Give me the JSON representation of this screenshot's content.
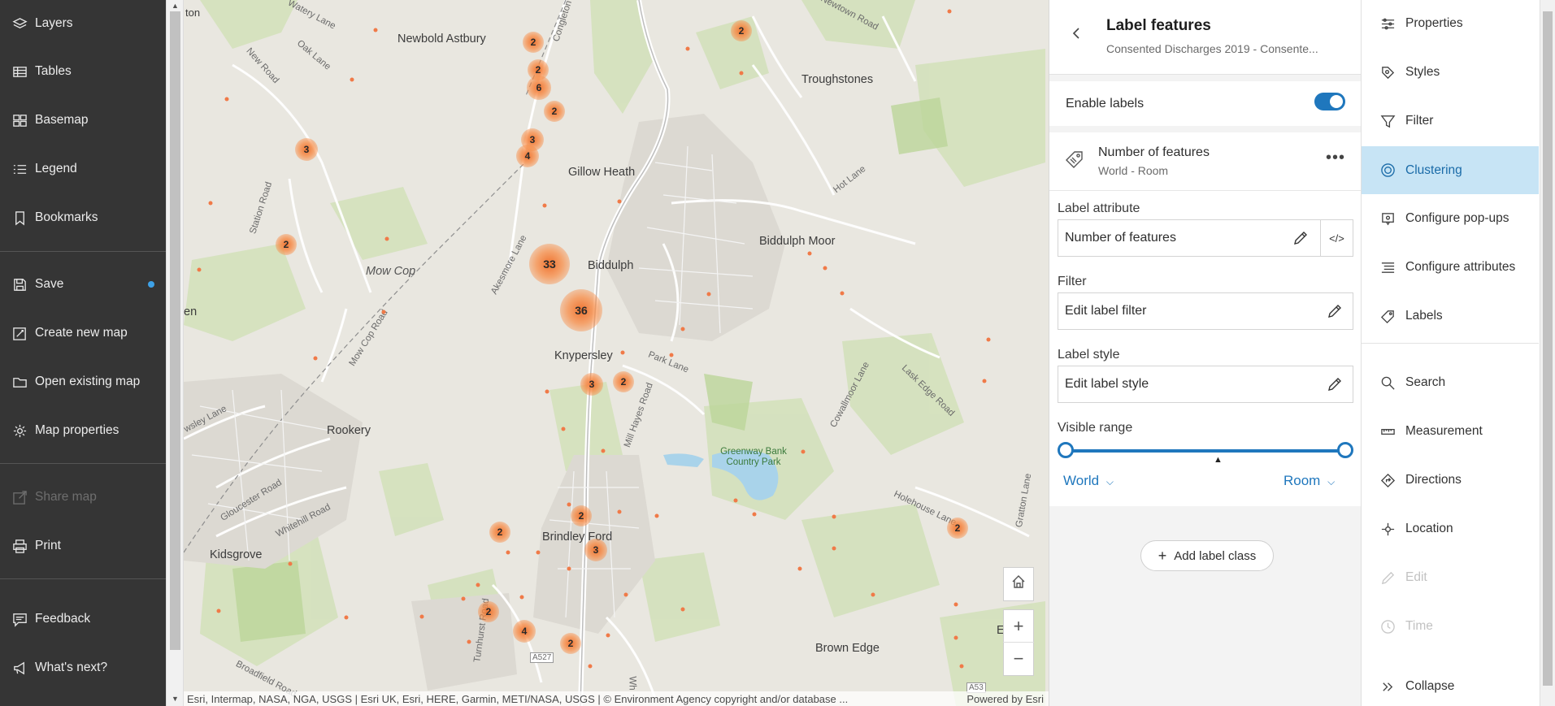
{
  "left_nav": {
    "items": [
      {
        "label": "Layers",
        "icon": "layers-icon"
      },
      {
        "label": "Tables",
        "icon": "table-icon"
      },
      {
        "label": "Basemap",
        "icon": "basemap-icon"
      },
      {
        "label": "Legend",
        "icon": "legend-icon"
      },
      {
        "label": "Bookmarks",
        "icon": "bookmark-icon"
      },
      {
        "label": "Save",
        "icon": "save-icon"
      },
      {
        "label": "Create new map",
        "icon": "create-map-icon"
      },
      {
        "label": "Open existing map",
        "icon": "folder-icon"
      },
      {
        "label": "Map properties",
        "icon": "gear-icon"
      },
      {
        "label": "Share map",
        "icon": "share-icon",
        "disabled": true
      },
      {
        "label": "Print",
        "icon": "print-icon"
      },
      {
        "label": "Feedback",
        "icon": "feedback-icon"
      },
      {
        "label": "What's next?",
        "icon": "megaphone-icon"
      }
    ],
    "unsaved_dot_color": "#3ea2e8"
  },
  "map": {
    "places": [
      "Newbold Astbury",
      "Troughstones",
      "Gillow Heath",
      "Biddulph Moor",
      "Biddulph",
      "Mow Cop",
      "Knypersley",
      "Rookery",
      "Kidsgrove",
      "Brindley Ford",
      "Brown Edge",
      "Greenway Bank Country Park"
    ],
    "streets": [
      "Watery Lane",
      "Congleton",
      "Newtown Road",
      "New Road",
      "Oak Lane",
      "Station Road",
      "Station Road",
      "Akesmore Lane",
      "Hot Lane",
      "Mow Cop Road",
      "Park Lane",
      "Mill Hayes Road",
      "Cowallmoor Lane",
      "Lask Edge Road",
      "Gloucester Road",
      "Whitehill Road",
      "Holehouse Lane",
      "Gratton Lane",
      "Turnhurst Road",
      "Broadfield Road",
      "A527",
      "A53"
    ],
    "edge_labels": [
      "ton",
      "en",
      "wsley Lane",
      "E",
      "Wh"
    ],
    "clusters": [
      "2",
      "2",
      "2",
      "6",
      "2",
      "3",
      "4",
      "3",
      "2",
      "33",
      "36",
      "3",
      "2",
      "2",
      "2",
      "3",
      "2",
      "4",
      "2",
      "2"
    ],
    "attribution": "Esri, Intermap, NASA, NGA, USGS | Esri UK, Esri, HERE, Garmin, METI/NASA, USGS | © Environment Agency copyright and/or database ...",
    "powered_by": "Powered by Esri",
    "controls": {
      "home": "home-icon",
      "zoom_in": "+",
      "zoom_out": "−"
    }
  },
  "panel": {
    "title": "Label features",
    "subtitle": "Consented Discharges 2019 - Consente...",
    "enable_labels": "Enable labels",
    "enable_on": true,
    "label_class": {
      "title": "Number of features",
      "range": "World - Room"
    },
    "label_attribute": {
      "label": "Label attribute",
      "value": "Number of features"
    },
    "filter": {
      "label": "Filter",
      "value": "Edit label filter"
    },
    "label_style": {
      "label": "Label style",
      "value": "Edit label style"
    },
    "visible_range": {
      "label": "Visible range",
      "min": "World",
      "max": "Room"
    },
    "add_label_class": "Add label class",
    "accent_color": "#1f77bd"
  },
  "right_nav": {
    "items": [
      {
        "label": "Properties",
        "icon": "properties-icon"
      },
      {
        "label": "Styles",
        "icon": "styles-icon"
      },
      {
        "label": "Filter",
        "icon": "filter-icon"
      },
      {
        "label": "Clustering",
        "icon": "clustering-icon",
        "active": true
      },
      {
        "label": "Configure pop-ups",
        "icon": "popup-icon"
      },
      {
        "label": "Configure attributes",
        "icon": "attributes-icon"
      },
      {
        "label": "Labels",
        "icon": "labels-icon"
      },
      {
        "label": "Search",
        "icon": "search-icon"
      },
      {
        "label": "Measurement",
        "icon": "measurement-icon"
      },
      {
        "label": "Directions",
        "icon": "directions-icon"
      },
      {
        "label": "Location",
        "icon": "location-icon"
      },
      {
        "label": "Edit",
        "icon": "edit-icon",
        "disabled": true
      },
      {
        "label": "Time",
        "icon": "time-icon",
        "disabled": true
      },
      {
        "label": "Collapse",
        "icon": "collapse-icon"
      }
    ],
    "active_bg": "#c7e4f5"
  }
}
